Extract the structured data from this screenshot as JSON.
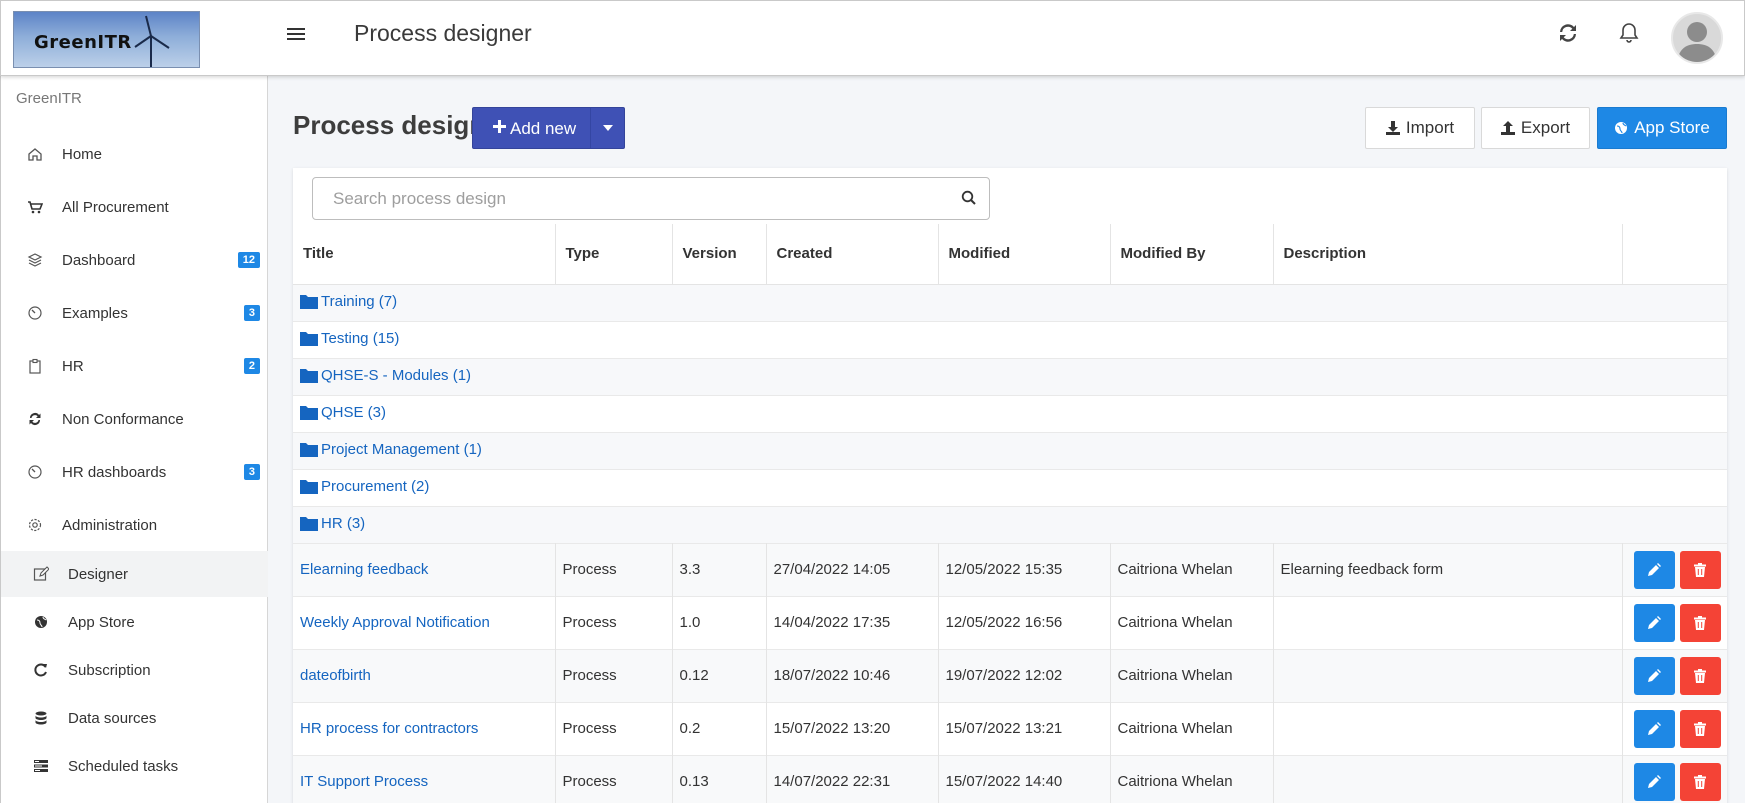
{
  "header": {
    "logo_text": "GreenITR",
    "title": "Process designer",
    "icons": [
      "menu-icon",
      "refresh-icon",
      "bell-icon",
      "user-avatar"
    ]
  },
  "sidebar": {
    "brand": "GreenITR",
    "items": [
      {
        "label": "Home",
        "icon": "home-icon",
        "badge": ""
      },
      {
        "label": "All Procurement",
        "icon": "cart-icon",
        "badge": ""
      },
      {
        "label": "Dashboard",
        "icon": "layers-icon",
        "badge": "12"
      },
      {
        "label": "Examples",
        "icon": "gauge-icon",
        "badge": "3"
      },
      {
        "label": "HR",
        "icon": "clipboard-icon",
        "badge": "2"
      },
      {
        "label": "Non Conformance",
        "icon": "refresh-icon",
        "badge": ""
      },
      {
        "label": "HR dashboards",
        "icon": "gauge-icon",
        "badge": "3"
      },
      {
        "label": "Administration",
        "icon": "gear-icon",
        "badge": ""
      }
    ],
    "subitems": [
      {
        "label": "Designer",
        "icon": "edit-icon",
        "active": true
      },
      {
        "label": "App Store",
        "icon": "globe-icon",
        "active": false
      },
      {
        "label": "Subscription",
        "icon": "rotate-icon",
        "active": false
      },
      {
        "label": "Data sources",
        "icon": "database-icon",
        "active": false
      },
      {
        "label": "Scheduled tasks",
        "icon": "tasks-icon",
        "active": false
      }
    ]
  },
  "main": {
    "heading": "Process design",
    "add_new": "Add new",
    "import": "Import",
    "export": "Export",
    "app_store": "App Store",
    "search_placeholder": "Search process design",
    "search_value": ""
  },
  "table": {
    "columns": [
      "Title",
      "Type",
      "Version",
      "Created",
      "Modified",
      "Modified By",
      "Description",
      ""
    ],
    "folders": [
      "Training (7)",
      "Testing (15)",
      "QHSE-S - Modules (1)",
      "QHSE (3)",
      "Project Management (1)",
      "Procurement (2)",
      "HR (3)"
    ],
    "rows": [
      {
        "title": "Elearning feedback",
        "type": "Process",
        "version": "3.3",
        "created": "27/04/2022 14:05",
        "modified": "12/05/2022 15:35",
        "modified_by": "Caitriona Whelan",
        "description": "Elearning feedback form"
      },
      {
        "title": "Weekly Approval Notification",
        "type": "Process",
        "version": "1.0",
        "created": "14/04/2022 17:35",
        "modified": "12/05/2022 16:56",
        "modified_by": "Caitriona Whelan",
        "description": ""
      },
      {
        "title": "dateofbirth",
        "type": "Process",
        "version": "0.12",
        "created": "18/07/2022 10:46",
        "modified": "19/07/2022 12:02",
        "modified_by": "Caitriona Whelan",
        "description": ""
      },
      {
        "title": "HR process for contractors",
        "type": "Process",
        "version": "0.2",
        "created": "15/07/2022 13:20",
        "modified": "15/07/2022 13:21",
        "modified_by": "Caitriona Whelan",
        "description": ""
      },
      {
        "title": "IT Support Process",
        "type": "Process",
        "version": "0.13",
        "created": "14/07/2022 22:31",
        "modified": "15/07/2022 14:40",
        "modified_by": "Caitriona Whelan",
        "description": ""
      }
    ]
  },
  "colors": {
    "primary": "#3f51b5",
    "info": "#1e88e5",
    "danger": "#f44336",
    "link": "#1565c0"
  }
}
